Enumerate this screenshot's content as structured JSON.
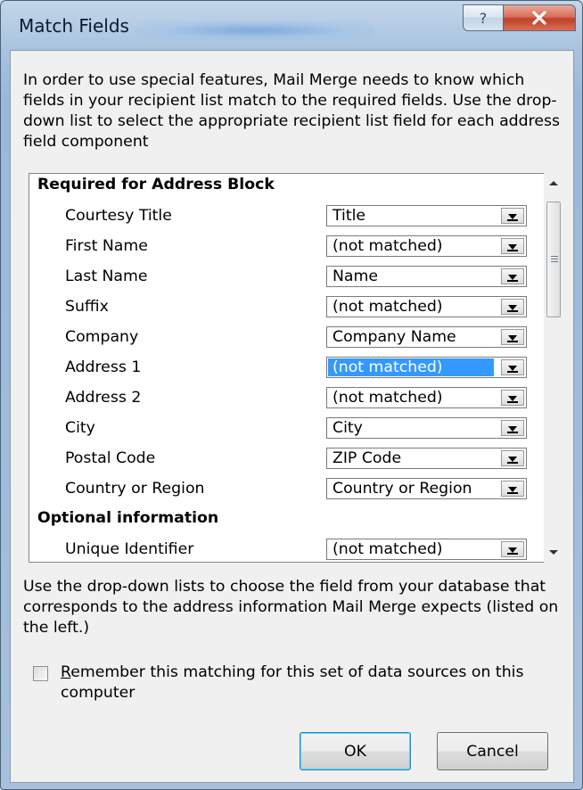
{
  "window": {
    "title": "Match Fields"
  },
  "title_buttons": {
    "help": "?",
    "close": "X"
  },
  "intro": "In order to use special features, Mail Merge needs to know which fields in your recipient list match to the required fields.  Use the drop-down list to select the appropriate recipient list field for each address field component",
  "sections": {
    "required": "Required for Address Block",
    "optional": "Optional information"
  },
  "fields": [
    {
      "label": "Courtesy Title",
      "value": "Title"
    },
    {
      "label": "First Name",
      "value": "(not matched)"
    },
    {
      "label": "Last Name",
      "value": "Name"
    },
    {
      "label": "Suffix",
      "value": "(not matched)"
    },
    {
      "label": "Company",
      "value": "Company Name"
    },
    {
      "label": "Address 1",
      "value": "(not matched)"
    },
    {
      "label": "Address 2",
      "value": "(not matched)"
    },
    {
      "label": "City",
      "value": "City"
    },
    {
      "label": "Postal Code",
      "value": "ZIP Code"
    },
    {
      "label": "Country or Region",
      "value": "Country or Region"
    },
    {
      "label": "Unique Identifier",
      "value": "(not matched)"
    }
  ],
  "help_text": "Use the drop-down lists to choose the field from your database that corresponds to the address information Mail Merge expects (listed on the left.)",
  "remember": {
    "label_prefix": "R",
    "label_rest": "emember this matching for this set of data sources on this computer",
    "checked": false
  },
  "buttons": {
    "ok": "OK",
    "cancel": "Cancel"
  }
}
